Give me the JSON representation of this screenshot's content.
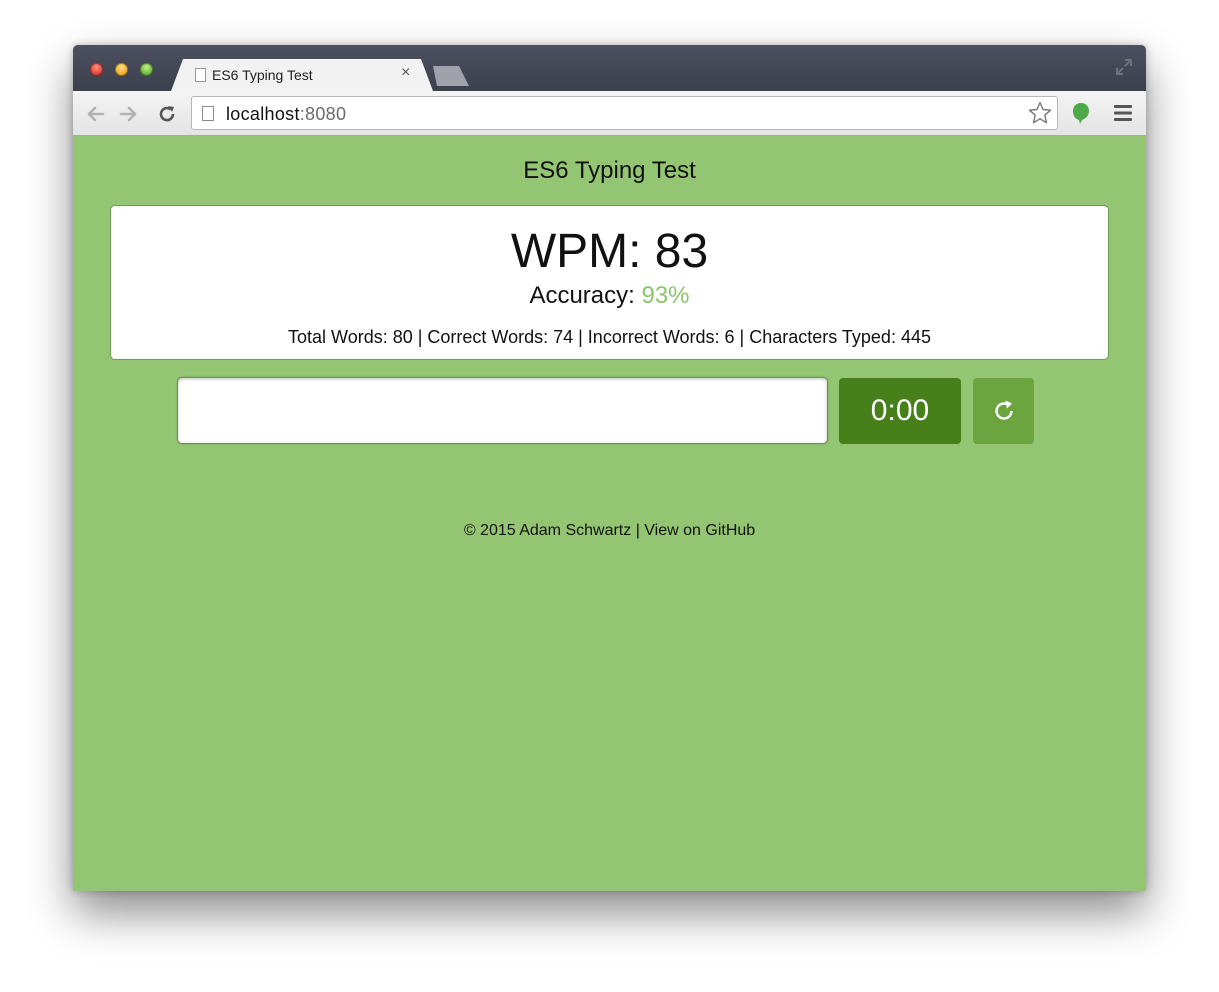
{
  "browser": {
    "tab_title": "ES6 Typing Test",
    "tab_close": "×",
    "url_host": "localhost",
    "url_port": ":8080"
  },
  "page": {
    "title": "ES6 Typing Test",
    "wpm_label": "WPM: 83",
    "accuracy_label": "Accuracy: ",
    "accuracy_value": "93%",
    "details": "Total Words: 80 | Correct Words: 74 | Incorrect Words: 6 | Characters Typed: 445",
    "input_value": "",
    "timer": "0:00",
    "footer_copyright": "© 2015 Adam Schwartz",
    "footer_separator": " | ",
    "footer_link": "View on GitHub"
  },
  "colors": {
    "background": "#94c572",
    "accuracy": "#8bc46a",
    "timer_bg": "#47801b",
    "restart_bg": "#6ca440"
  },
  "icons": {
    "back": "back-arrow-icon",
    "forward": "forward-arrow-icon",
    "reload": "reload-icon",
    "star": "bookmark-star-icon",
    "extension": "evernote-extension-icon",
    "menu": "hamburger-menu-icon",
    "restart": "restart-icon"
  }
}
